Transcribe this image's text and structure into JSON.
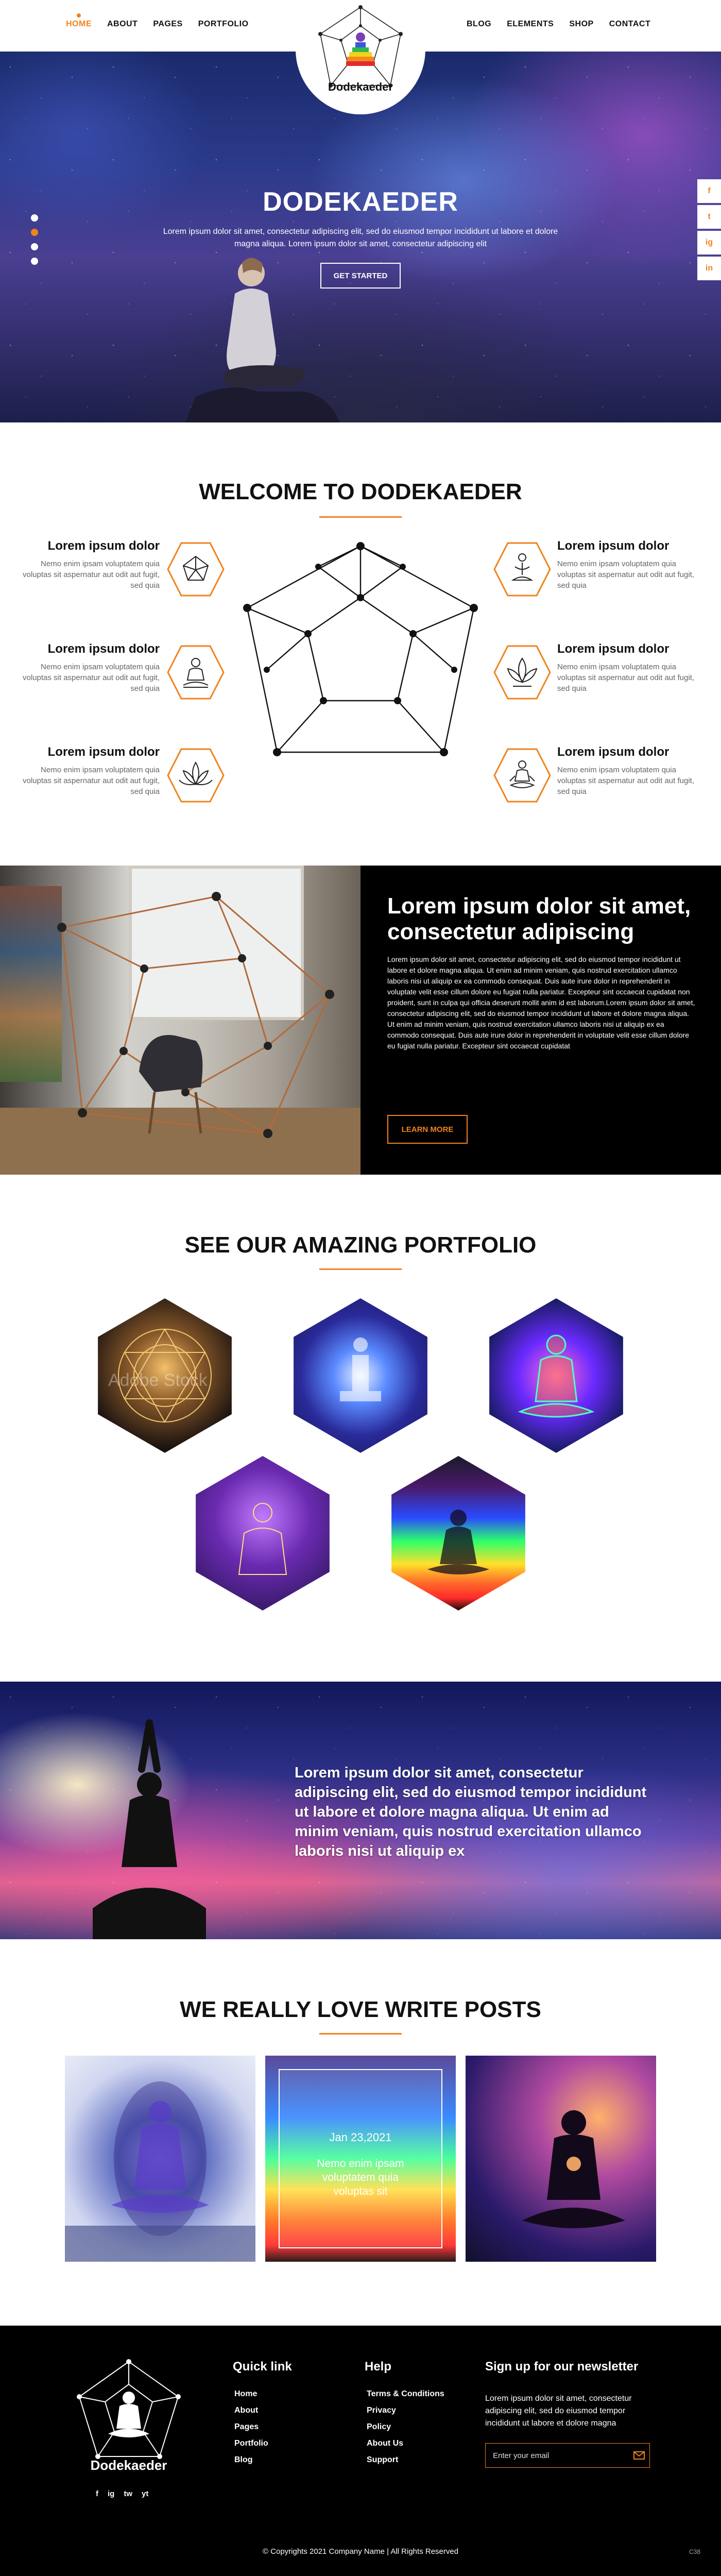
{
  "nav": {
    "left": [
      {
        "label": "HOME",
        "active": true
      },
      {
        "label": "ABOUT"
      },
      {
        "label": "PAGES"
      },
      {
        "label": "PORTFOLIO"
      }
    ],
    "right": [
      {
        "label": "BLOG"
      },
      {
        "label": "ELEMENTS"
      },
      {
        "label": "SHOP"
      },
      {
        "label": "CONTACT"
      }
    ],
    "logo_text": "Dodekaeder"
  },
  "hero": {
    "title": "DODEKAEDER",
    "text": "Lorem ipsum dolor sit amet, consectetur adipiscing elit, sed do eiusmod tempor incididunt ut labore et dolore magna aliqua. Lorem ipsum dolor sit amet, consectetur adipiscing elit",
    "button": "GET STARTED",
    "social": [
      "f",
      "t",
      "ig",
      "in"
    ]
  },
  "welcome": {
    "title": "WELCOME TO DODEKAEDER",
    "features": [
      {
        "title": "Lorem ipsum dolor",
        "text": "Nemo enim ipsam voluptatem quia voluptas sit aspernatur aut odit aut fugit, sed quia",
        "icon": "dodecahedron-icon"
      },
      {
        "title": "Lorem ipsum dolor",
        "text": "Nemo enim ipsam voluptatem quia voluptas sit aspernatur aut odit aut fugit, sed quia",
        "icon": "buddha-icon"
      },
      {
        "title": "Lorem ipsum dolor",
        "text": "Nemo enim ipsam voluptatem quia voluptas sit aspernatur aut odit aut fugit, sed quia",
        "icon": "lotus-icon"
      },
      {
        "title": "Lorem ipsum dolor",
        "text": "Nemo enim ipsam voluptatem quia voluptas sit aspernatur aut odit aut fugit, sed quia",
        "icon": "meditation-hands-icon"
      },
      {
        "title": "Lorem ipsum dolor",
        "text": "Nemo enim ipsam voluptatem quia voluptas sit aspernatur aut odit aut fugit, sed quia",
        "icon": "lotus-flower-icon"
      },
      {
        "title": "Lorem ipsum dolor",
        "text": "Nemo enim ipsam voluptatem quia voluptas sit aspernatur aut odit aut fugit, sed quia",
        "icon": "meditating-person-icon"
      }
    ]
  },
  "about": {
    "title": "Lorem ipsum dolor sit amet, consectetur adipiscing",
    "text": "Lorem ipsum dolor sit amet, consectetur adipiscing elit, sed do eiusmod tempor incididunt ut labore et dolore magna aliqua. Ut enim ad minim veniam, quis nostrud exercitation ullamco laboris nisi ut aliquip ex ea commodo consequat. Duis aute irure dolor in reprehenderit in voluptate velit esse cillum dolore eu fugiat nulla pariatur. Excepteur sint occaecat cupidatat non proident, sunt in culpa qui officia deserunt mollit anim id est laborum.Lorem ipsum dolor sit amet, consectetur adipiscing elit, sed do eiusmod tempor incididunt ut labore et dolore magna aliqua. Ut enim ad minim veniam, quis nostrud exercitation ullamco laboris nisi ut aliquip ex ea commodo consequat. Duis aute irure dolor in reprehenderit in voluptate velit esse cillum dolore eu fugiat nulla pariatur. Excepteur sint occaecat cupidatat",
    "button": "LEARN MORE"
  },
  "portfolio": {
    "title": "SEE OUR AMAZING PORTFOLIO",
    "items": [
      {
        "label": "sacred-geometry"
      },
      {
        "label": "cosmic-figure"
      },
      {
        "label": "neon-meditation"
      },
      {
        "label": "rainbow-aura"
      },
      {
        "label": "chakra-light"
      }
    ],
    "watermark": "Adobe Stock"
  },
  "banner": {
    "text": "Lorem ipsum dolor sit amet, consectetur adipiscing elit, sed do eiusmod tempor incididunt ut labore et dolore magna aliqua. Ut enim ad minim veniam, quis nostrud exercitation ullamco laboris nisi ut aliquip ex"
  },
  "posts": {
    "title": "WE REALLY LOVE WRITE POSTS",
    "featured_date": "Jan 23,2021",
    "featured_text": "Nemo enim ipsam voluptatem quia voluptas sit"
  },
  "footer": {
    "quick_title": "Quick link",
    "quick_links": [
      "Home",
      "About",
      "Pages",
      "Portfolio",
      "Blog"
    ],
    "help_title": "Help",
    "help_links": [
      "Terms & Conditions",
      "Privacy",
      "Policy",
      "About Us",
      "Support"
    ],
    "newsletter_title": "Sign up for our newsletter",
    "newsletter_text": "Lorem ipsum dolor sit amet, consectetur adipiscing elit, sed do eiusmod tempor incididunt ut labore et dolore magna",
    "email_placeholder": "Enter your email",
    "logo_text": "Dodekaeder",
    "social": [
      "f",
      "ig",
      "tw",
      "yt"
    ],
    "copyright": "© Copyrights 2021 Company Name  |  All Rights Reserved",
    "badge": "C38"
  },
  "colors": {
    "accent": "#f0831e",
    "dark": "#000000"
  }
}
